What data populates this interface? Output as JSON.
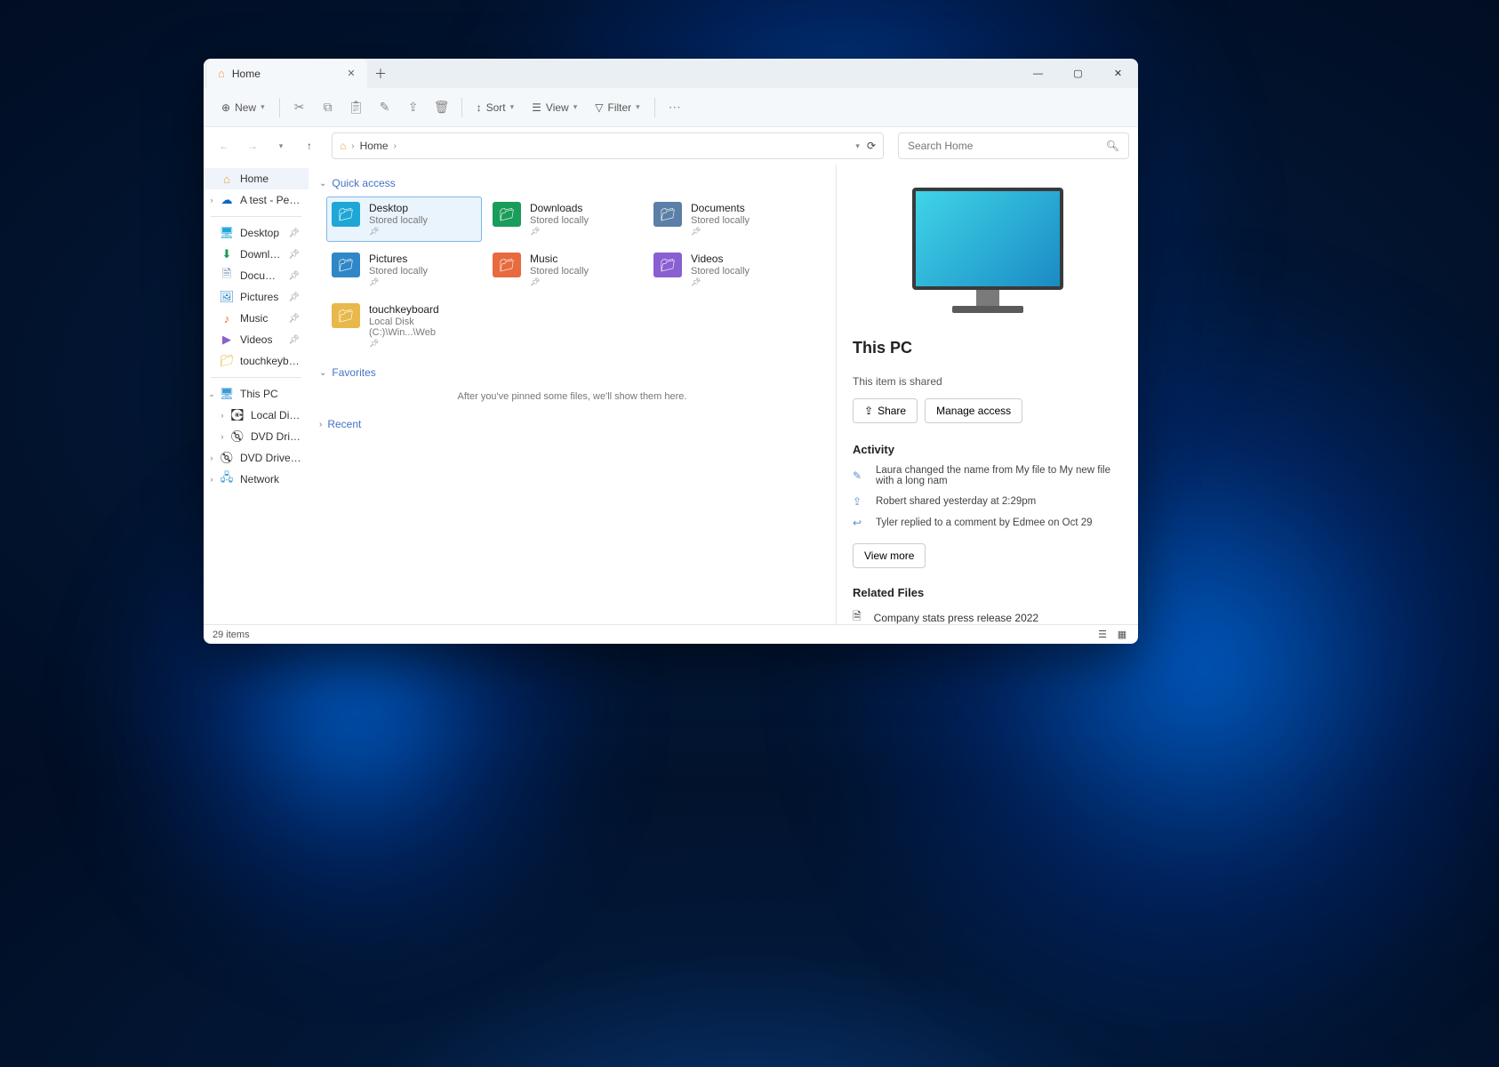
{
  "tab": {
    "title": "Home"
  },
  "toolbar": {
    "new": "New",
    "sort": "Sort",
    "view": "View",
    "filter": "Filter"
  },
  "breadcrumb": {
    "home": "Home"
  },
  "search": {
    "placeholder": "Search Home"
  },
  "sidebar": {
    "home": "Home",
    "atest": "A test - Personal",
    "pinned": [
      "Desktop",
      "Downloads",
      "Documents",
      "Pictures",
      "Music",
      "Videos",
      "touchkeyboard"
    ],
    "thispc": "This PC",
    "local": "Local Disk (C:)",
    "dvd1": "DVD Drive (D:) CCC",
    "dvd2": "DVD Drive (D:) CCC",
    "network": "Network"
  },
  "sections": {
    "quick": "Quick access",
    "fav": "Favorites",
    "recent": "Recent"
  },
  "quick": [
    {
      "name": "Desktop",
      "sub": "Stored locally",
      "color": "#1ea7d6"
    },
    {
      "name": "Downloads",
      "sub": "Stored locally",
      "color": "#1a9c5b"
    },
    {
      "name": "Documents",
      "sub": "Stored locally",
      "color": "#5b7fa6"
    },
    {
      "name": "Pictures",
      "sub": "Stored locally",
      "color": "#2f87c7"
    },
    {
      "name": "Music",
      "sub": "Stored locally",
      "color": "#e86a3f"
    },
    {
      "name": "Videos",
      "sub": "Stored locally",
      "color": "#8a5fd1"
    },
    {
      "name": "touchkeyboard",
      "sub": "Local Disk (C:)\\Win...\\Web",
      "color": "#e8b94a"
    }
  ],
  "favEmpty": "After you've pinned some files, we'll show them here.",
  "details": {
    "title": "This PC",
    "shared": "This item is shared",
    "share": "Share",
    "manage": "Manage access",
    "activity": "Activity",
    "acts": [
      "Laura changed the name from My file to My new file with a long nam",
      "Robert shared yesterday at 2:29pm",
      "Tyler replied to a comment by Edmee on Oct 29"
    ],
    "viewmore": "View more",
    "related": "Related Files",
    "rfile": "Company stats press release 2022"
  },
  "status": {
    "count": "29 items"
  }
}
